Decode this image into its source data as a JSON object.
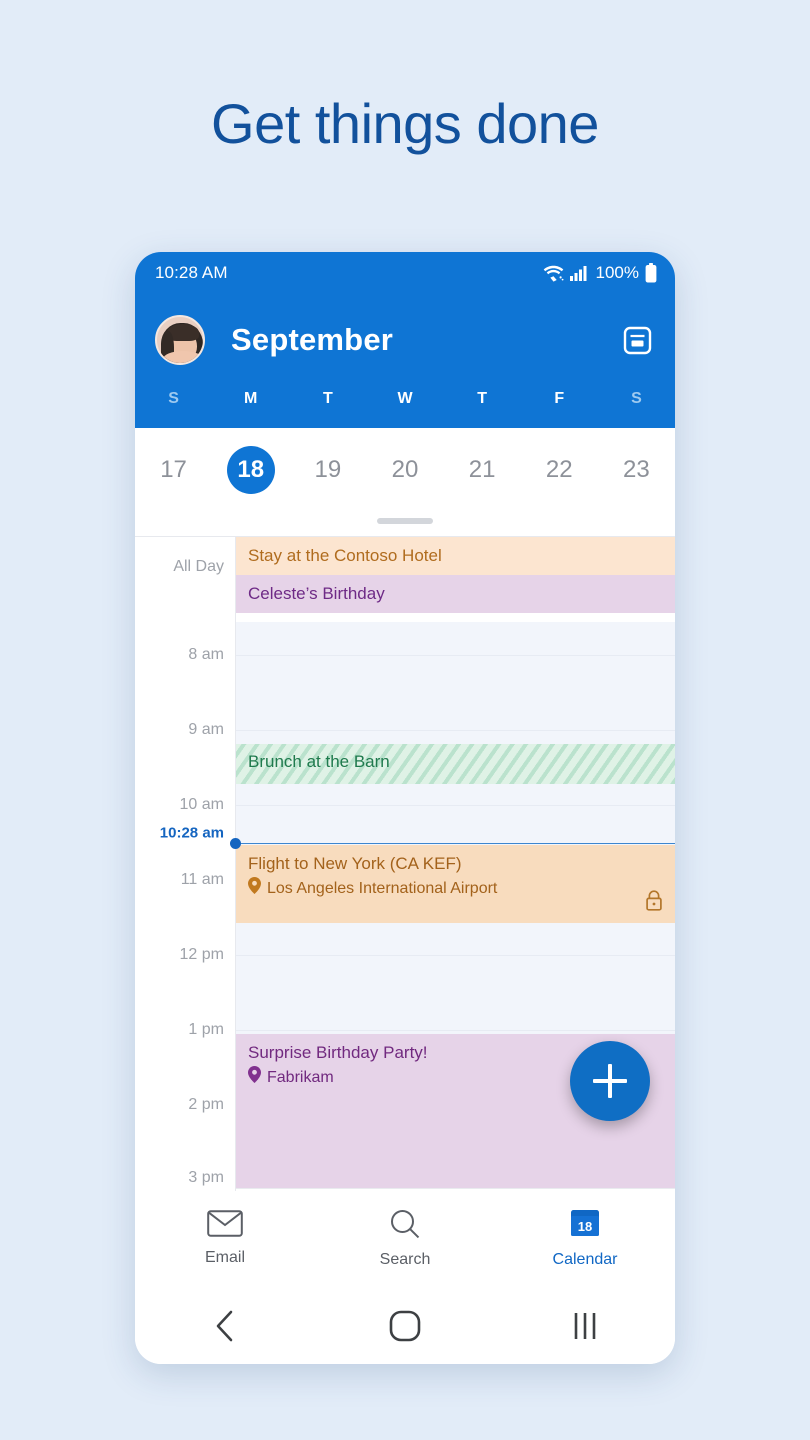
{
  "headline": "Get things done",
  "statusbar": {
    "time": "10:28 AM",
    "battery_pct": "100%",
    "wifi_icon": "wifi-icon",
    "signal_icon": "cellular-signal-icon",
    "battery_icon": "battery-full-icon"
  },
  "header": {
    "avatar_icon": "user-avatar",
    "month": "September",
    "action_icon": "agenda-view-icon"
  },
  "weekdays": [
    {
      "label": "S",
      "dim": true
    },
    {
      "label": "M",
      "dim": false
    },
    {
      "label": "T",
      "dim": false
    },
    {
      "label": "W",
      "dim": false
    },
    {
      "label": "T",
      "dim": false
    },
    {
      "label": "F",
      "dim": false
    },
    {
      "label": "S",
      "dim": true
    }
  ],
  "dates": [
    {
      "num": "17",
      "selected": false
    },
    {
      "num": "18",
      "selected": true
    },
    {
      "num": "19",
      "selected": false
    },
    {
      "num": "20",
      "selected": false
    },
    {
      "num": "21",
      "selected": false
    },
    {
      "num": "22",
      "selected": false
    },
    {
      "num": "23",
      "selected": false
    }
  ],
  "agenda": {
    "all_day_label": "All Day",
    "all_day_events": [
      {
        "title": "Stay at the Contoso Hotel",
        "style": "hotel"
      },
      {
        "title": "Celeste’s Birthday",
        "style": "bday"
      }
    ],
    "hour_labels": [
      "8 am",
      "9 am",
      "10 am",
      "11 am",
      "12 pm",
      "1 pm",
      "2 pm",
      "3 pm"
    ],
    "now_label": "10:28 am",
    "events": [
      {
        "title": "Brunch at the Barn",
        "location": "",
        "style": "brunch",
        "private": false
      },
      {
        "title": "Flight to New York (CA KEF)",
        "location": "Los Angeles International Airport",
        "style": "flight",
        "private": true,
        "location_icon": "location-pin-icon",
        "lock_icon": "lock-icon"
      },
      {
        "title": "Surprise Birthday Party!",
        "location": "Fabrikam",
        "style": "party",
        "private": false,
        "location_icon": "location-pin-icon"
      }
    ]
  },
  "fab": {
    "icon": "plus-icon",
    "label": "Add event"
  },
  "bottomnav": [
    {
      "label": "Email",
      "icon": "envelope-icon",
      "active": false
    },
    {
      "label": "Search",
      "icon": "magnifier-icon",
      "active": false
    },
    {
      "label": "Calendar",
      "icon": "calendar-icon",
      "active": true,
      "badge": "18"
    }
  ],
  "sysnav": [
    {
      "icon": "back-icon"
    },
    {
      "icon": "home-icon"
    },
    {
      "icon": "recents-icon"
    }
  ],
  "colors": {
    "page_bg": "#e2ecf8",
    "brand_blue": "#0f75d4",
    "headline_blue": "#12519c",
    "accent_blue": "#1067c4",
    "hotel_bg": "#fce5d0",
    "hotel_fg": "#b06c1e",
    "bday_bg": "#e6d3e8",
    "bday_fg": "#6e2a86",
    "brunch_bg": "#dff2e6",
    "brunch_fg": "#1f7a4d",
    "flight_bg": "#f8dcbe",
    "flight_fg": "#a3621b",
    "party_fg": "#71297f",
    "grid_bg": "#f2f5fb"
  }
}
